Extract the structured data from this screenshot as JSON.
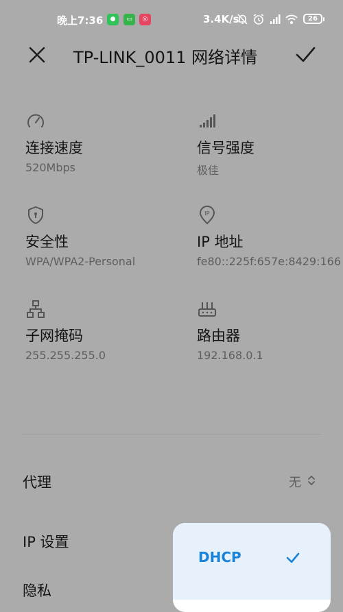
{
  "status_bar": {
    "time": "晚上7:36",
    "network_speed": "3.4K/s",
    "battery": "26",
    "colors": {
      "wechat": "#2fc35a",
      "message": "#38b24a",
      "instagram": "#e6455f"
    }
  },
  "header": {
    "title": "TP-LINK_0011 网络详情",
    "close_icon": "close-icon",
    "confirm_icon": "check-icon"
  },
  "details": [
    {
      "icon": "speedometer-icon",
      "label": "连接速度",
      "value": "520Mbps"
    },
    {
      "icon": "signal-bars-icon",
      "label": "信号强度",
      "value": "极佳"
    },
    {
      "icon": "shield-icon",
      "label": "安全性",
      "value": "WPA/WPA2-Personal"
    },
    {
      "icon": "ip-pin-icon",
      "label": "IP 地址",
      "value": "fe80::225f:657e:8429:166"
    },
    {
      "icon": "network-topology-icon",
      "label": "子网掩码",
      "value": "255.255.255.0"
    },
    {
      "icon": "router-icon",
      "label": "路由器",
      "value": "192.168.0.1"
    }
  ],
  "settings": {
    "proxy_label": "代理",
    "proxy_value": "无",
    "ip_settings_label": "IP 设置",
    "privacy_label": "隐私"
  },
  "popup": {
    "selected_option": "DHCP",
    "accent": "#1a82d6"
  }
}
